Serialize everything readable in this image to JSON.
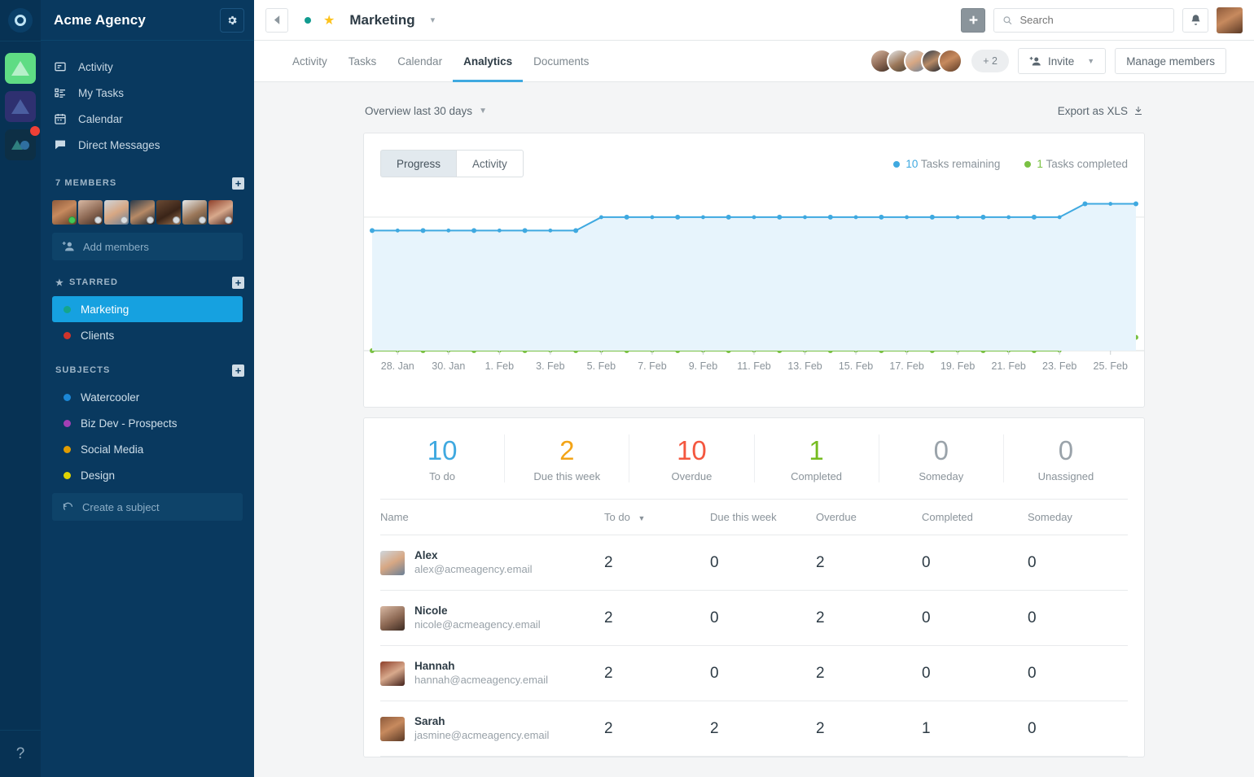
{
  "rail": {
    "logo_icon": "app-logo-icon",
    "tiles": [
      {
        "name": "workspace-tile-green",
        "icon": "triangle-icon"
      },
      {
        "name": "workspace-tile-purple",
        "icon": "triangle-icon"
      },
      {
        "name": "workspace-tile-dark",
        "icon": "triangle-circle-icon",
        "badge": true
      }
    ],
    "help_label": "?"
  },
  "sidebar": {
    "title": "Acme Agency",
    "settings_icon": "gear-icon",
    "nav": [
      {
        "label": "Activity",
        "icon": "activity-icon"
      },
      {
        "label": "My Tasks",
        "icon": "tasks-icon"
      },
      {
        "label": "Calendar",
        "icon": "calendar-icon"
      },
      {
        "label": "Direct Messages",
        "icon": "chat-icon"
      }
    ],
    "members_header": "7 MEMBERS",
    "members_add_icon": "plus-icon",
    "member_avatars": [
      {
        "name": "member-avatar-1",
        "status": "on"
      },
      {
        "name": "member-avatar-2",
        "status": "off"
      },
      {
        "name": "member-avatar-3",
        "status": "off"
      },
      {
        "name": "member-avatar-4",
        "status": "off"
      },
      {
        "name": "member-avatar-5",
        "status": "off"
      },
      {
        "name": "member-avatar-6",
        "status": "off"
      },
      {
        "name": "member-avatar-7",
        "status": "off"
      }
    ],
    "add_members_label": "Add members",
    "add_members_icon": "add-person-icon",
    "starred_header": "STARRED",
    "starred_icon": "star-icon",
    "starred_add_icon": "plus-icon",
    "starred": [
      {
        "label": "Marketing",
        "color": "#14a58c",
        "active": true
      },
      {
        "label": "Clients",
        "color": "#d0342c",
        "active": false
      }
    ],
    "subjects_header": "SUBJECTS",
    "subjects_add_icon": "plus-icon",
    "subjects": [
      {
        "label": "Watercooler",
        "color": "#1b87d6"
      },
      {
        "label": "Biz Dev - Prospects",
        "color": "#a23fb5"
      },
      {
        "label": "Social Media",
        "color": "#e09c02"
      },
      {
        "label": "Design",
        "color": "#e0d302"
      }
    ],
    "create_subject_label": "Create a subject",
    "create_subject_icon": "refresh-icon"
  },
  "topbar": {
    "back_icon": "back-arrow-icon",
    "project_status_color": "#119b8f",
    "project_star_icon": "star-icon",
    "project_name": "Marketing",
    "project_chevron_icon": "chevron-down-icon",
    "add_button_label": "+",
    "search_icon": "search-icon",
    "search_placeholder": "Search",
    "search_value": "",
    "bell_icon": "bell-icon",
    "avatar_name": "user-avatar"
  },
  "tabs": [
    {
      "label": "Activity",
      "active": false
    },
    {
      "label": "Tasks",
      "active": false
    },
    {
      "label": "Calendar",
      "active": false
    },
    {
      "label": "Analytics",
      "active": true
    },
    {
      "label": "Documents",
      "active": false
    }
  ],
  "tabbar_right": {
    "overflow_label": "+ 2",
    "invite_label": "Invite",
    "invite_icon": "add-person-icon",
    "invite_chevron_icon": "chevron-down-icon",
    "manage_label": "Manage members"
  },
  "toolbar": {
    "range_label": "Overview last 30 days",
    "range_chevron_icon": "chevron-down-icon",
    "export_label": "Export as XLS",
    "export_icon": "download-icon"
  },
  "chart_panel": {
    "segments": [
      {
        "label": "Progress",
        "active": true
      },
      {
        "label": "Activity",
        "active": false
      }
    ],
    "legend": [
      {
        "value": "10",
        "label": "Tasks remaining",
        "color": "#3fa9e0"
      },
      {
        "value": "1",
        "label": "Tasks completed",
        "color": "#7ac143"
      }
    ]
  },
  "chart_data": {
    "type": "area",
    "title": "Overview last 30 days",
    "xlabel": "",
    "ylabel": "",
    "grid": false,
    "legend_position": "top-right",
    "ylim": [
      0,
      11
    ],
    "tick_labels": [
      "28. Jan",
      "30. Jan",
      "1. Feb",
      "3. Feb",
      "5. Feb",
      "7. Feb",
      "9. Feb",
      "11. Feb",
      "13. Feb",
      "15. Feb",
      "17. Feb",
      "19. Feb",
      "21. Feb",
      "23. Feb",
      "25. Feb"
    ],
    "x": [
      "27. Jan",
      "28. Jan",
      "29. Jan",
      "30. Jan",
      "31. Jan",
      "1. Feb",
      "2. Feb",
      "3. Feb",
      "4. Feb",
      "5. Feb",
      "6. Feb",
      "7. Feb",
      "8. Feb",
      "9. Feb",
      "10. Feb",
      "11. Feb",
      "12. Feb",
      "13. Feb",
      "14. Feb",
      "15. Feb",
      "16. Feb",
      "17. Feb",
      "18. Feb",
      "19. Feb",
      "20. Feb",
      "21. Feb",
      "22. Feb",
      "23. Feb",
      "24. Feb",
      "25. Feb",
      "26. Feb"
    ],
    "series": [
      {
        "name": "Tasks remaining",
        "color": "#3fa9e0",
        "fill": "#e7f4fc",
        "values": [
          9,
          9,
          9,
          9,
          9,
          9,
          9,
          9,
          9,
          10,
          10,
          10,
          10,
          10,
          10,
          10,
          10,
          10,
          10,
          10,
          10,
          10,
          10,
          10,
          10,
          10,
          10,
          10,
          11,
          11,
          11
        ]
      },
      {
        "name": "Tasks completed",
        "color": "#7ac143",
        "fill": "#eef5e4",
        "values": [
          0,
          0,
          0,
          0,
          0,
          0,
          0,
          0,
          0,
          0,
          0,
          0,
          0,
          0,
          0,
          0,
          0,
          0,
          0,
          0,
          0,
          0,
          0,
          0,
          0,
          0,
          0,
          0,
          1,
          1,
          1
        ]
      }
    ]
  },
  "stats": [
    {
      "value": "10",
      "label": "To do",
      "color": "#3fa9e0"
    },
    {
      "value": "2",
      "label": "Due this week",
      "color": "#f3a417"
    },
    {
      "value": "10",
      "label": "Overdue",
      "color": "#f4573f"
    },
    {
      "value": "1",
      "label": "Completed",
      "color": "#76bc21"
    },
    {
      "value": "0",
      "label": "Someday",
      "color": "#9aa3aa"
    },
    {
      "value": "0",
      "label": "Unassigned",
      "color": "#9aa3aa"
    }
  ],
  "table": {
    "columns": [
      "Name",
      "To do",
      "Due this week",
      "Overdue",
      "Completed",
      "Someday"
    ],
    "sorted_column": "To do",
    "sort_icon": "sort-desc-icon",
    "rows": [
      {
        "name": "Alex",
        "email": "alex@acmeagency.email",
        "avatar": "f3",
        "todo": "2",
        "due": "0",
        "overdue": "2",
        "completed": "0",
        "someday": "0",
        "due_state": "zero",
        "overdue_state": "red",
        "completed_state": "zero",
        "someday_state": "zero"
      },
      {
        "name": "Nicole",
        "email": "nicole@acmeagency.email",
        "avatar": "f2",
        "todo": "2",
        "due": "0",
        "overdue": "2",
        "completed": "0",
        "someday": "0",
        "due_state": "zero",
        "overdue_state": "red",
        "completed_state": "zero",
        "someday_state": "zero"
      },
      {
        "name": "Hannah",
        "email": "hannah@acmeagency.email",
        "avatar": "f7",
        "todo": "2",
        "due": "0",
        "overdue": "2",
        "completed": "0",
        "someday": "0",
        "due_state": "zero",
        "overdue_state": "red",
        "completed_state": "zero",
        "someday_state": "zero"
      },
      {
        "name": "Sarah",
        "email": "jasmine@acmeagency.email",
        "avatar": "f1",
        "todo": "2",
        "due": "2",
        "overdue": "2",
        "completed": "1",
        "someday": "0",
        "due_state": "orange",
        "overdue_state": "red",
        "completed_state": "green2",
        "someday_state": "zero"
      }
    ]
  }
}
